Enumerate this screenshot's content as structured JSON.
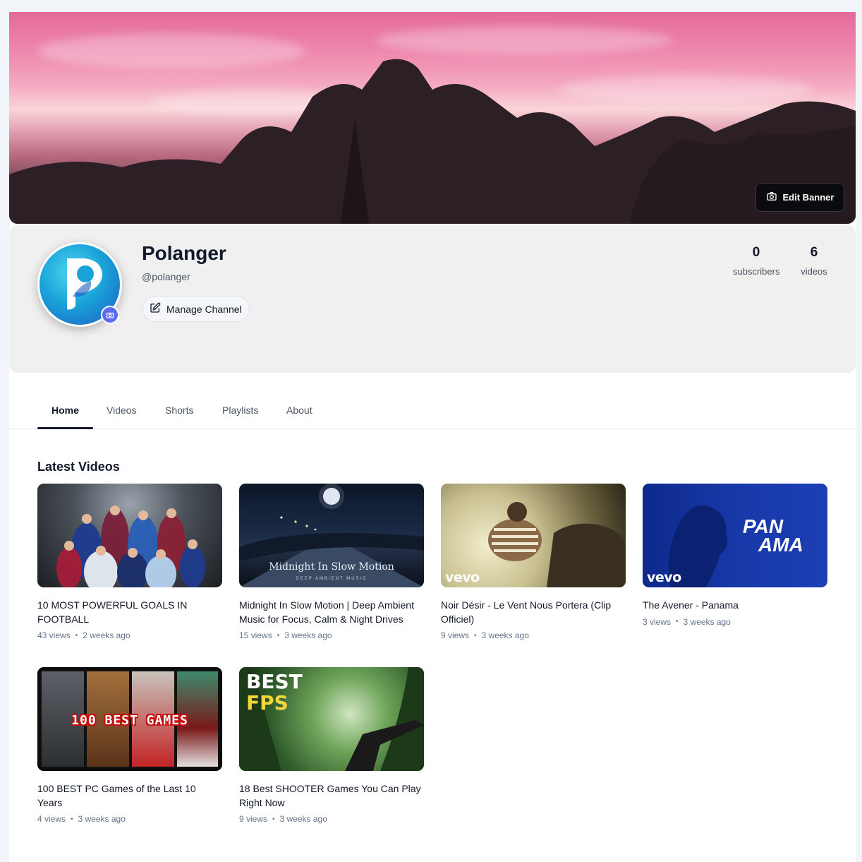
{
  "banner": {
    "edit_label": "Edit Banner"
  },
  "channel": {
    "name": "Polanger",
    "handle": "@polanger",
    "manage_label": "Manage Channel",
    "subscribers_count": "0",
    "subscribers_label": "subscribers",
    "videos_count": "6",
    "videos_label": "videos"
  },
  "tabs": [
    {
      "label": "Home",
      "active": true
    },
    {
      "label": "Videos"
    },
    {
      "label": "Shorts"
    },
    {
      "label": "Playlists"
    },
    {
      "label": "About"
    }
  ],
  "section": {
    "title": "Latest Videos"
  },
  "videos": [
    {
      "title": "10 MOST POWERFUL GOALS IN FOOTBALL",
      "views": "43 views",
      "age": "2 weeks ago"
    },
    {
      "title": "Midnight In Slow Motion | Deep Ambient Music for Focus, Calm & Night Drives",
      "views": "15 views",
      "age": "3 weeks ago",
      "thumb_text": "Midnight In Slow Motion",
      "thumb_sub": "DEEP AMBIENT MUSIC"
    },
    {
      "title": "Noir Désir - Le Vent Nous Portera (Clip Officiel)",
      "views": "9 views",
      "age": "3 weeks ago",
      "badge": "vevo"
    },
    {
      "title": "The Avener - Panama",
      "views": "3 views",
      "age": "3 weeks ago",
      "badge": "vevo",
      "thumb_text_1": "PAN",
      "thumb_text_2": "AMA"
    },
    {
      "title": "100 BEST PC Games of the Last 10 Years",
      "views": "4 views",
      "age": "3 weeks ago",
      "thumb_text": "100 BEST GAMES"
    },
    {
      "title": "18 Best SHOOTER Games You Can Play Right Now",
      "views": "9 views",
      "age": "3 weeks ago",
      "thumb_text_1": "BEST",
      "thumb_text_2": "FPS"
    }
  ]
}
